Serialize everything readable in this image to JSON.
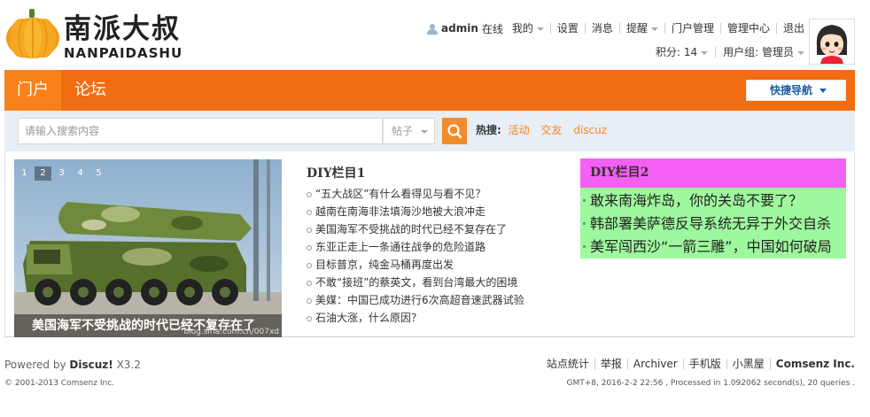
{
  "logo": {
    "title_cn": "南派大叔",
    "title_en": "NANPAIDASHU"
  },
  "userbar": {
    "username": "admin",
    "online": "在线",
    "items": [
      "我的",
      "设置",
      "消息",
      "提醒",
      "门户管理",
      "管理中心",
      "退出"
    ],
    "credits_label": "积分: 14",
    "group_label": "用户组: 管理员"
  },
  "nav": {
    "tabs": [
      "门户",
      "论坛"
    ],
    "quicknav": "快捷导航"
  },
  "search": {
    "placeholder": "请输入搜索内容",
    "type": "帖子",
    "hot_label": "热搜:",
    "hot_words": [
      "活动",
      "交友",
      "discuz"
    ]
  },
  "slideshow": {
    "pages": [
      "1",
      "2",
      "3",
      "4",
      "5"
    ],
    "active_page": "2",
    "caption": "美国海军不受挑战的时代已经不复存在了",
    "watermark": "blog.sina.com.cn/007xd"
  },
  "diy1": {
    "title": "DIY栏目1",
    "items": [
      "“五大战区”有什么看得见与看不见？",
      "越南在南海非法填海沙地被大浪冲走",
      "美国海军不受挑战的时代已经不复存在了",
      "东亚正走上一条通往战争的危险道路",
      "目标普京，纯金马桶再度出发",
      "不敢“接班”的蔡英文，看到台湾最大的困境",
      "美媒：中国已成功进行6次高超音速武器试验",
      "石油大涨，什么原因？"
    ]
  },
  "diy2": {
    "title": "DIY栏目2",
    "items": [
      "敢来南海炸岛，你的关岛不要了？",
      "韩部署美萨德反导系统无异于外交自杀",
      "美军闯西沙“一箭三雕”，中国如何破局"
    ]
  },
  "footer": {
    "powered_prefix": "Powered by",
    "powered_name": "Discuz!",
    "powered_version": "X3.2",
    "copyright": "© 2001-2013 Comsenz Inc.",
    "links": [
      "站点统计",
      "举报",
      "Archiver",
      "手机版",
      "小黑屋",
      "Comsenz Inc."
    ],
    "stats": "GMT+8, 2016-2-2 22:56 , Processed in 1.092062 second(s), 20 queries ."
  },
  "colors": {
    "nav_bg": "#f26c11",
    "nav_active": "#f9811b",
    "hot_word": "#f98524",
    "diy2_title_bg": "#f45ff4",
    "diy2_body_bg": "#9ef89e",
    "quicknav_text": "#175ea3"
  }
}
